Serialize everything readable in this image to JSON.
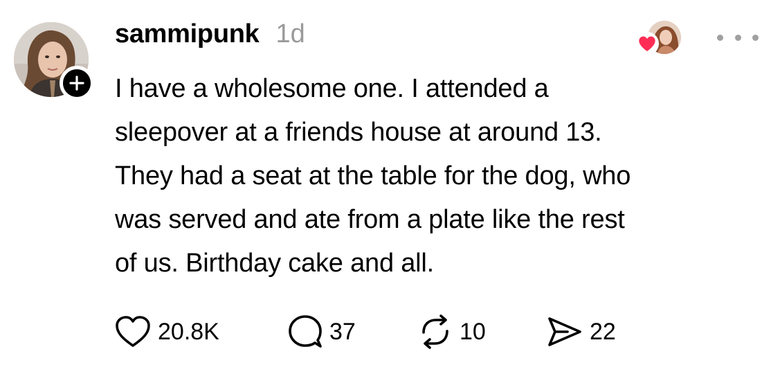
{
  "post": {
    "username": "sammipunk",
    "timestamp": "1d",
    "body_lines": [
      "I have a wholesome one. I attended a",
      "sleepover at a friends house at around 13.",
      "They had a seat at the table for the dog, who",
      "was served and ate from a plate like the rest",
      "of us. Birthday cake and all."
    ],
    "actions": {
      "like_count": "20.8K",
      "reply_count": "37",
      "repost_count": "10",
      "share_count": "22"
    },
    "icons": {
      "follow": "plus-icon",
      "liked_by": "heart-icon",
      "more": "more-icon",
      "like": "heart-outline-icon",
      "reply": "speech-bubble-icon",
      "repost": "repost-icon",
      "share": "send-icon"
    },
    "colors": {
      "text": "#000000",
      "muted": "#9a9a9a",
      "heart": "#ff2d55",
      "badge": "#000000"
    }
  }
}
